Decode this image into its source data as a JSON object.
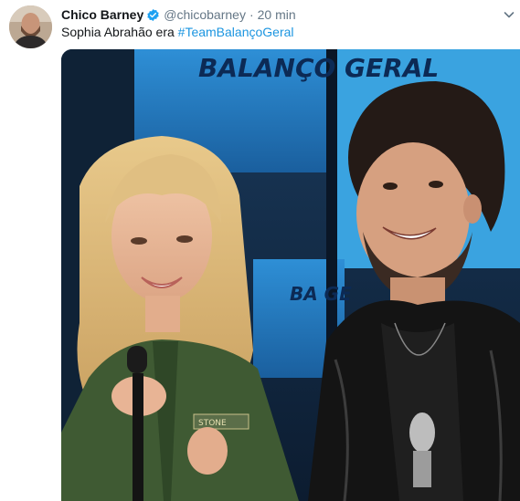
{
  "tweet": {
    "author": {
      "display_name": "Chico Barney",
      "handle": "@chicobarney",
      "verified": true,
      "avatar_icon": "avatar-photo"
    },
    "separator": "·",
    "timestamp": "20 min",
    "text_prefix": "Sophia Abrahão era ",
    "hashtag": "#TeamBalançoGeral",
    "menu_icon": "chevron-down-icon",
    "media": {
      "description": "",
      "backdrop_text_large": "BALANÇO GERAL",
      "backdrop_text_small": "BA GE",
      "shirt_patch_text": "STONE"
    }
  },
  "colors": {
    "text_primary": "#14171a",
    "text_secondary": "#657786",
    "link": "#1b95e0",
    "verified": "#1da1f2"
  }
}
